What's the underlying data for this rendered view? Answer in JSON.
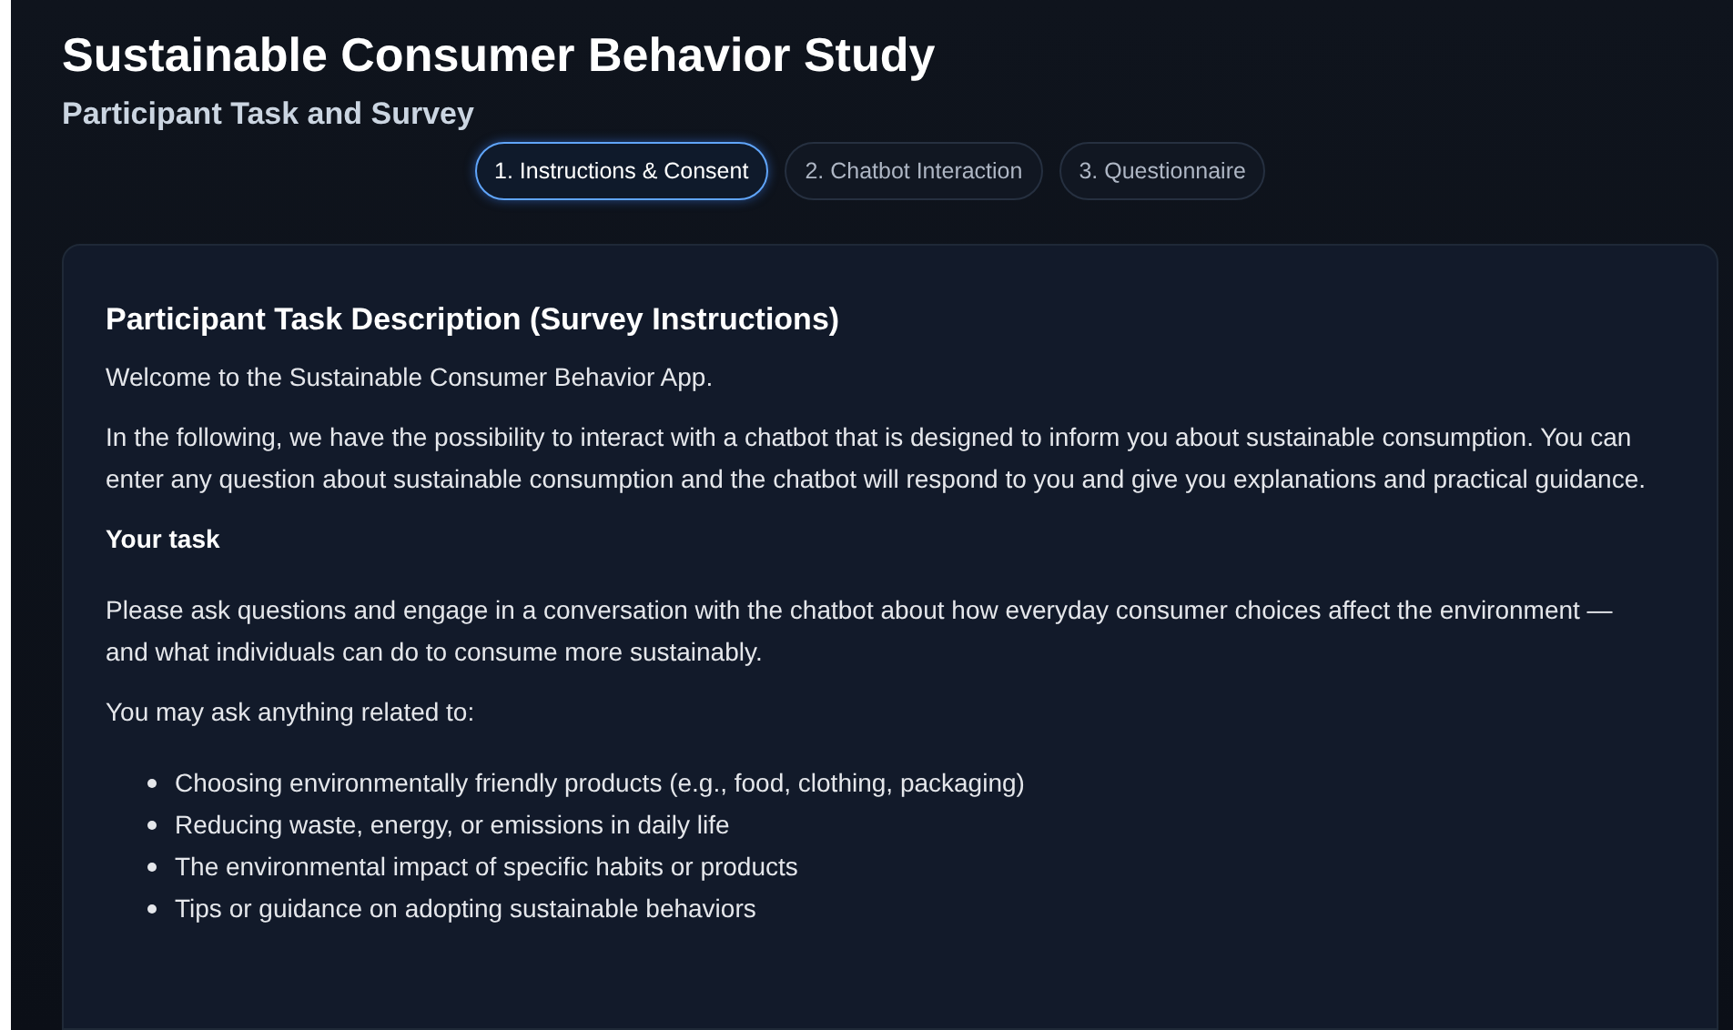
{
  "header": {
    "title": "Sustainable Consumer Behavior Study",
    "subtitle": "Participant Task and Survey"
  },
  "steps": [
    {
      "label": "1. Instructions & Consent",
      "selected": true
    },
    {
      "label": "2. Chatbot Interaction",
      "selected": false
    },
    {
      "label": "3. Questionnaire",
      "selected": false
    }
  ],
  "card": {
    "heading": "Participant Task Description (Survey Instructions)",
    "blocks": [
      {
        "kind": "paragraph",
        "text": "Welcome to the Sustainable Consumer Behavior App."
      },
      {
        "kind": "paragraph",
        "text": "In the following, we have the possibility to interact with a chatbot that is designed to inform you about sustainable consumption. You can enter any question about sustainable consumption and the chatbot will respond to you and give you explanations and practical guidance."
      },
      {
        "kind": "subheading",
        "text": "Your task"
      },
      {
        "kind": "paragraph",
        "text": "Please ask questions and engage in a conversation with the chatbot about how everyday consumer choices affect the environment — and what individuals can do to consume more sustainably."
      },
      {
        "kind": "paragraph",
        "text": "You may ask anything related to:"
      },
      {
        "kind": "list",
        "items": [
          "Choosing environmentally friendly products (e.g., food, clothing, packaging)",
          "Reducing waste, energy, or emissions in daily life",
          "The environmental impact of specific habits or products",
          "Tips or guidance on adopting sustainable behaviors"
        ]
      }
    ]
  }
}
